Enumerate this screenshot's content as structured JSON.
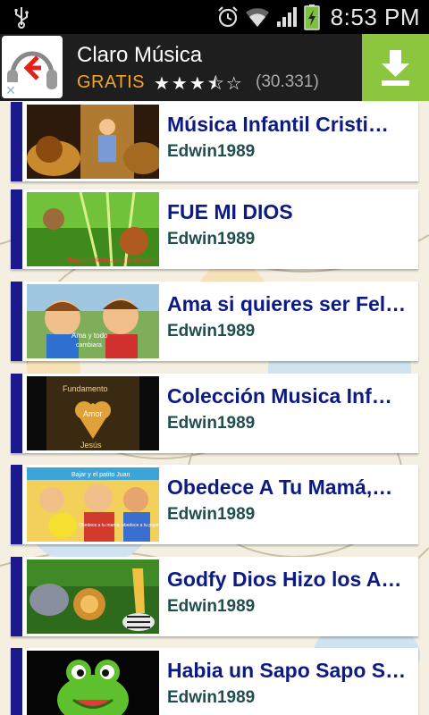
{
  "status_bar": {
    "time": "8:53 PM",
    "icons": [
      "usb-icon",
      "alarm-icon",
      "wifi-icon",
      "signal-icon",
      "battery-charging-icon"
    ]
  },
  "ad": {
    "app_name": "Claro Música",
    "price": "GRATIS",
    "rating_stars": "★★★⯪☆",
    "rating_value": 3.5,
    "rating_count": "(30.331)",
    "close_label": "✕",
    "colors": {
      "price": "#f5a623",
      "download_bg": "#8cc63e"
    }
  },
  "list": {
    "items": [
      {
        "title": "Música Infantil Cristi…",
        "author": "Edwin1989"
      },
      {
        "title": "FUE MI DIOS",
        "author": "Edwin1989"
      },
      {
        "title": "Ama si quieres ser Fel…",
        "author": "Edwin1989"
      },
      {
        "title": "Colección Musica Inf…",
        "author": "Edwin1989"
      },
      {
        "title": "Obedece A Tu Mamá,…",
        "author": "Edwin1989"
      },
      {
        "title": "Godfy Dios Hizo los A…",
        "author": "Edwin1989"
      },
      {
        "title": "Habia un Sapo Sapo S…",
        "author": "Edwin1989"
      }
    ],
    "thumb_captions": {
      "t2": "Sing to children, sing to children",
      "t3a": "Ama y todo",
      "t3b": "cambiara",
      "t4a": "Fundamento",
      "t4b": "Amor",
      "t4c": "Jesús",
      "t5a": "Bajar y el patito Juan",
      "t5b": "Obedece a tu mamá, obedece a tu papá"
    },
    "colors": {
      "accent_bar": "#1a1a8c",
      "title": "#0c1a84",
      "author": "#1e4e4e"
    }
  }
}
